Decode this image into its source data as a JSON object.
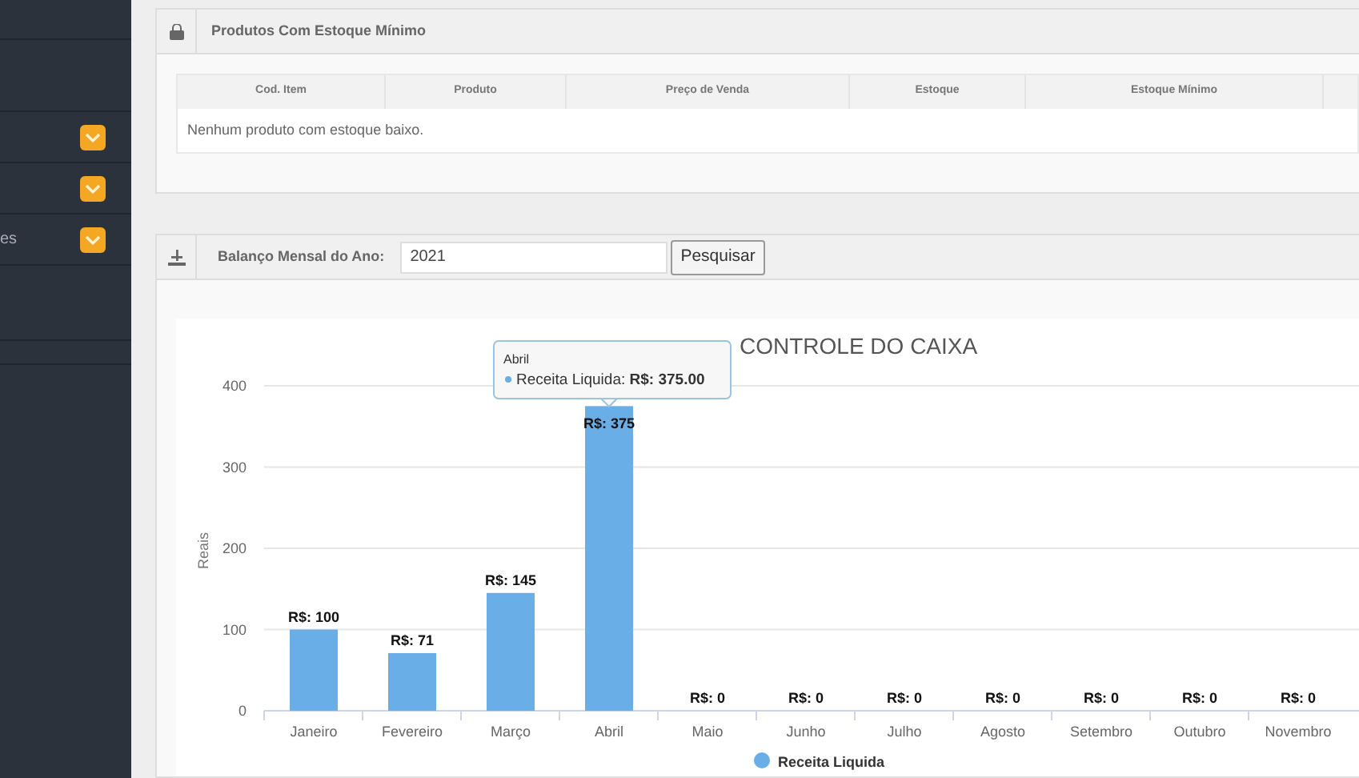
{
  "sidebar": {
    "items": [
      {
        "kind": "dropdown"
      },
      {
        "kind": "dropdown"
      },
      {
        "kind": "dropdown",
        "label": "es"
      }
    ]
  },
  "stock_panel": {
    "title": "Produtos Com Estoque Mínimo",
    "columns": [
      "Cod. Item",
      "Produto",
      "Preço de Venda",
      "Estoque",
      "Estoque Mínimo"
    ],
    "empty_message": "Nenhum produto com estoque baixo."
  },
  "balance_panel": {
    "label": "Balanço Mensal do Ano:",
    "year": "2021",
    "search_button": "Pesquisar"
  },
  "chart": {
    "tooltip": {
      "title": "Abril",
      "series": "Receita Liquida:",
      "value": "R$: 375.00"
    },
    "chart_data": {
      "type": "bar",
      "title": "CONTROLE DO CAIXA",
      "ylabel": "Reais",
      "categories": [
        "Janeiro",
        "Fevereiro",
        "Março",
        "Abril",
        "Maio",
        "Junho",
        "Julho",
        "Agosto",
        "Setembro",
        "Outubro",
        "Novembro"
      ],
      "series": [
        {
          "name": "Receita Liquida",
          "color": "#6aaee8",
          "values": [
            100,
            71,
            145,
            375,
            0,
            0,
            0,
            0,
            0,
            0,
            0
          ]
        }
      ],
      "ylim": [
        0,
        400
      ],
      "grid": true,
      "yticks": [
        0,
        100,
        200,
        300,
        400
      ],
      "value_labels": [
        "R$: 100",
        "R$: 71",
        "R$: 145",
        "R$: 375",
        "R$: 0",
        "R$: 0",
        "R$: 0",
        "R$: 0",
        "R$: 0",
        "R$: 0",
        "R$: 0"
      ]
    }
  }
}
